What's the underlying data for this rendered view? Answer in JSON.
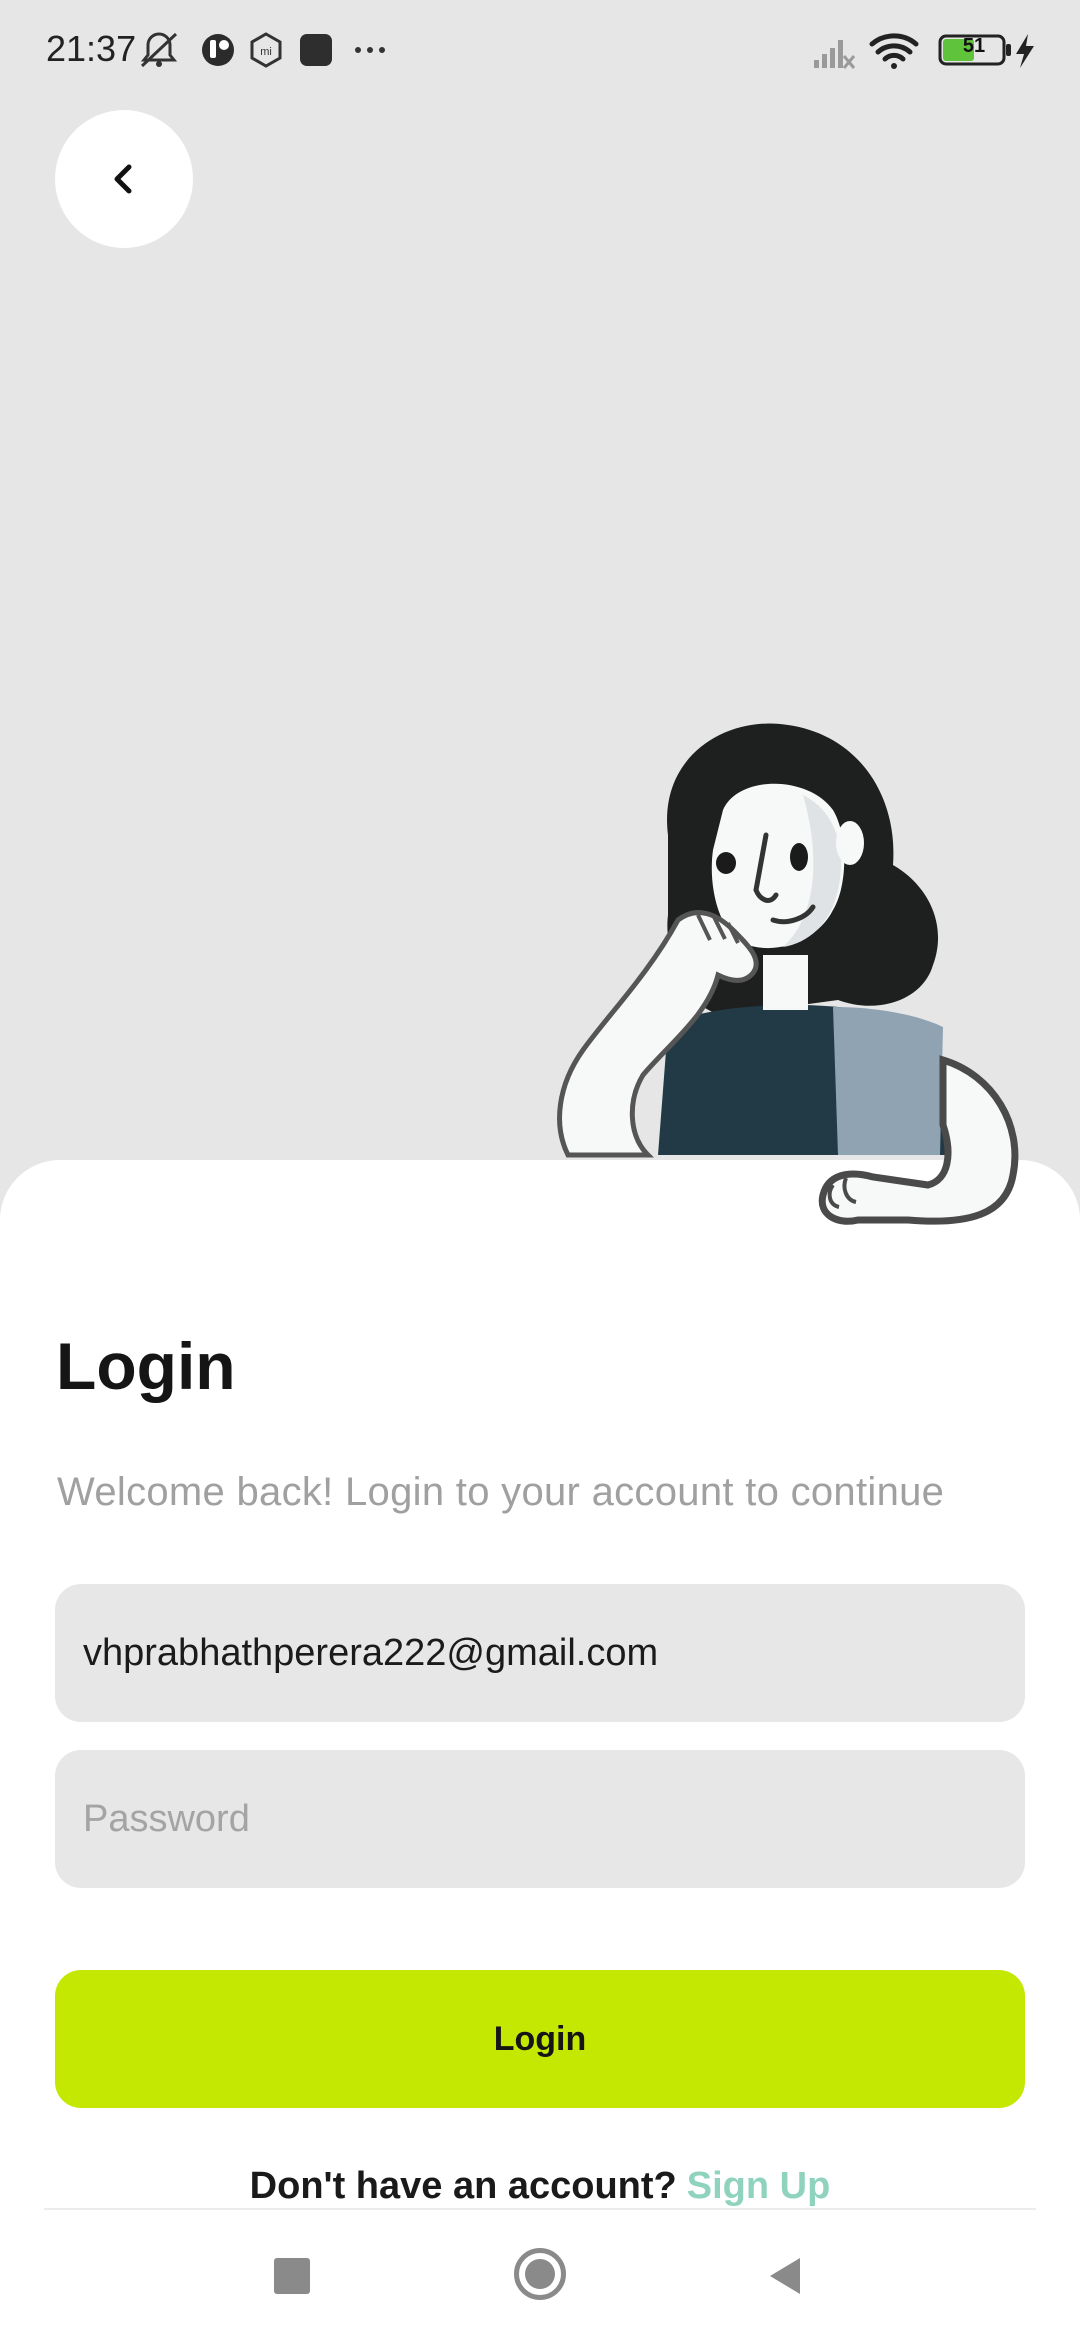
{
  "status_bar": {
    "time": "21:37",
    "battery_level": "51",
    "left_icons": [
      "muted-bell-icon",
      "app-notification-icon",
      "mi-icon",
      "square-app-icon",
      "more-dots-icon"
    ],
    "right_icons": [
      "signal-off-icon",
      "wifi-icon",
      "battery-icon",
      "charging-bolt-icon"
    ]
  },
  "header": {
    "back_icon": "chevron-left-icon"
  },
  "illustration": {
    "name": "thinking-woman-illustration"
  },
  "login": {
    "title": "Login",
    "subtitle": "Welcome back! Login to your account to continue",
    "email_value": "vhprabhathperera222@gmail.com",
    "password_placeholder": "Password",
    "button_label": "Login",
    "signup_prompt": "Don't have an account?",
    "signup_link": "Sign Up"
  },
  "colors": {
    "accent": "#c5e803",
    "link": "#8fd3bf",
    "background": "#e6e6e6",
    "field": "#e7e7e7"
  },
  "nav_bar": {
    "icons": [
      "recent-apps-icon",
      "home-icon",
      "back-triangle-icon"
    ]
  }
}
